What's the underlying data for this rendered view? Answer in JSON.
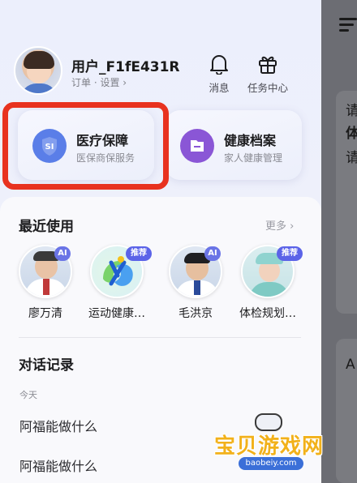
{
  "header": {
    "username": "用户_F1fE431R",
    "user_links": "订单 · 设置 ›",
    "notifications_label": "消息",
    "tasks_label": "任务中心"
  },
  "services": [
    {
      "title": "医疗保障",
      "subtitle": "医保商保服务",
      "icon_text": "SI",
      "icon": "shield-icon"
    },
    {
      "title": "健康档案",
      "subtitle": "家人健康管理",
      "icon": "folder-icon"
    }
  ],
  "recent": {
    "title": "最近使用",
    "more_label": "更多 ›",
    "items": [
      {
        "label": "廖万清",
        "badge": "AI"
      },
      {
        "label": "运动健康…",
        "badge": "推荐"
      },
      {
        "label": "毛洪京",
        "badge": "AI"
      },
      {
        "label": "体检规划…",
        "badge": "推荐"
      }
    ]
  },
  "history": {
    "title": "对话记录",
    "group_label": "今天",
    "items": [
      "阿福能做什么",
      "阿福能做什么"
    ]
  },
  "background_page": {
    "texts": [
      "请",
      "体",
      "请",
      "A"
    ]
  },
  "watermark": {
    "text": "宝贝游戏网",
    "url": "baobeiy.com"
  },
  "colors": {
    "accent": "#5b63e8",
    "highlight_border": "#e8321f"
  }
}
